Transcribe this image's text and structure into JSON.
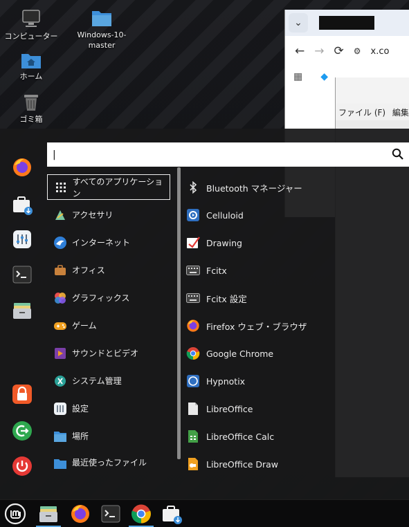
{
  "desktop": {
    "icons": [
      {
        "label": "コンピューター",
        "icon": "computer-icon"
      },
      {
        "label": "ホーム",
        "icon": "home-folder-icon"
      },
      {
        "label": "ゴミ箱",
        "icon": "trash-icon"
      },
      {
        "label": "Windows-10-\nmaster",
        "icon": "folder-icon"
      }
    ]
  },
  "browser": {
    "url_partial": "x.co",
    "nav_back": "←",
    "nav_forward": "→",
    "nav_reload": "⟳"
  },
  "file_manager": {
    "menu_file": "ファイル (F)",
    "menu_edit": "編集 ("
  },
  "search": {
    "value": "",
    "cursor": "|"
  },
  "categories": [
    {
      "label": "すべてのアプリケーション",
      "icon": "grid-icon",
      "selected": true
    },
    {
      "label": "アクセサリ",
      "icon": "accessories-icon"
    },
    {
      "label": "インターネット",
      "icon": "internet-icon"
    },
    {
      "label": "オフィス",
      "icon": "briefcase-icon"
    },
    {
      "label": "グラフィックス",
      "icon": "graphics-icon"
    },
    {
      "label": "ゲーム",
      "icon": "gamepad-icon"
    },
    {
      "label": "サウンドとビデオ",
      "icon": "media-icon"
    },
    {
      "label": "システム管理",
      "icon": "system-icon"
    },
    {
      "label": "設定",
      "icon": "settings-icon"
    },
    {
      "label": "場所",
      "icon": "places-folder-icon"
    },
    {
      "label": "最近使ったファイル",
      "icon": "recent-files-icon"
    }
  ],
  "apps": [
    {
      "label": "Bluetooth マネージャー",
      "icon": "bluetooth-icon"
    },
    {
      "label": "Celluloid",
      "icon": "celluloid-icon"
    },
    {
      "label": "Drawing",
      "icon": "drawing-icon"
    },
    {
      "label": "Fcitx",
      "icon": "keyboard-icon"
    },
    {
      "label": "Fcitx 設定",
      "icon": "keyboard-settings-icon"
    },
    {
      "label": "Firefox ウェブ・ブラウザ",
      "icon": "firefox-icon"
    },
    {
      "label": "Google Chrome",
      "icon": "chrome-icon"
    },
    {
      "label": "Hypnotix",
      "icon": "hypnotix-icon"
    },
    {
      "label": "LibreOffice",
      "icon": "libreoffice-icon"
    },
    {
      "label": "LibreOffice Calc",
      "icon": "calc-icon"
    },
    {
      "label": "LibreOffice Draw",
      "icon": "draw-icon"
    }
  ],
  "favorites": [
    {
      "name": "firefox-icon"
    },
    {
      "name": "software-store-icon"
    },
    {
      "name": "system-settings-icon"
    },
    {
      "name": "terminal-icon"
    },
    {
      "name": "files-icon"
    },
    {
      "name": "lock-screen-icon"
    },
    {
      "name": "logout-icon"
    },
    {
      "name": "power-icon"
    }
  ],
  "taskbar": {
    "items": [
      {
        "name": "mint-menu-icon"
      },
      {
        "name": "files-icon"
      },
      {
        "name": "firefox-icon"
      },
      {
        "name": "terminal-icon"
      },
      {
        "name": "chrome-icon"
      },
      {
        "name": "software-store-icon"
      }
    ]
  },
  "colors": {
    "accent": "#5aa6e0",
    "menu_bg": "#18181a",
    "folder_blue": "#3d8fd9",
    "mint_green": "#8bc34a"
  }
}
